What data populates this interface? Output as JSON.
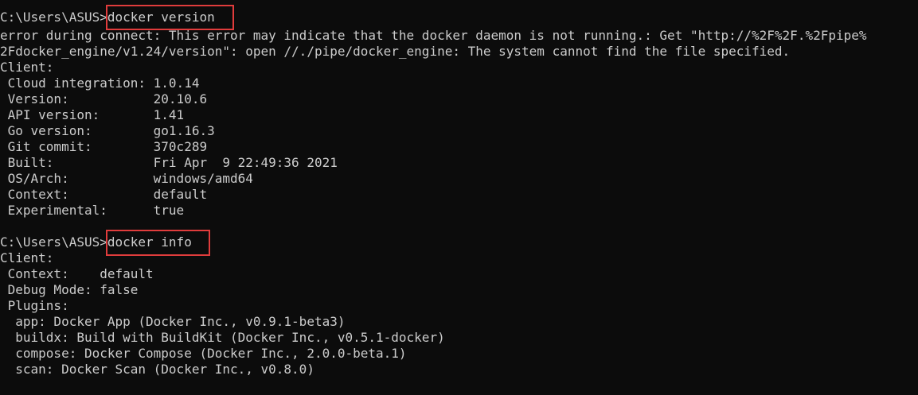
{
  "terminal": {
    "lines": [
      {
        "prompt": "C:\\Users\\ASUS>",
        "command": "docker version"
      },
      {
        "text": "error during connect: This error may indicate that the docker daemon is not running.: Get \"http://%2F%2F.%2Fpipe%"
      },
      {
        "text": "2Fdocker_engine/v1.24/version\": open //./pipe/docker_engine: The system cannot find the file specified."
      },
      {
        "text": "Client:"
      },
      {
        "text": " Cloud integration: 1.0.14"
      },
      {
        "text": " Version:           20.10.6"
      },
      {
        "text": " API version:       1.41"
      },
      {
        "text": " Go version:        go1.16.3"
      },
      {
        "text": " Git commit:        370c289"
      },
      {
        "text": " Built:             Fri Apr  9 22:49:36 2021"
      },
      {
        "text": " OS/Arch:           windows/amd64"
      },
      {
        "text": " Context:           default"
      },
      {
        "text": " Experimental:      true"
      },
      {
        "text": ""
      },
      {
        "prompt": "C:\\Users\\ASUS>",
        "command": "docker info"
      },
      {
        "text": "Client:"
      },
      {
        "text": " Context:    default"
      },
      {
        "text": " Debug Mode: false"
      },
      {
        "text": " Plugins:"
      },
      {
        "text": "  app: Docker App (Docker Inc., v0.9.1-beta3)"
      },
      {
        "text": "  buildx: Build with BuildKit (Docker Inc., v0.5.1-docker)"
      },
      {
        "text": "  compose: Docker Compose (Docker Inc., 2.0.0-beta.1)"
      },
      {
        "text": "  scan: Docker Scan (Docker Inc., v0.8.0)"
      }
    ]
  },
  "colors": {
    "background": "#0c0c0c",
    "foreground": "#cccccc",
    "highlight": "#e03c3c"
  }
}
